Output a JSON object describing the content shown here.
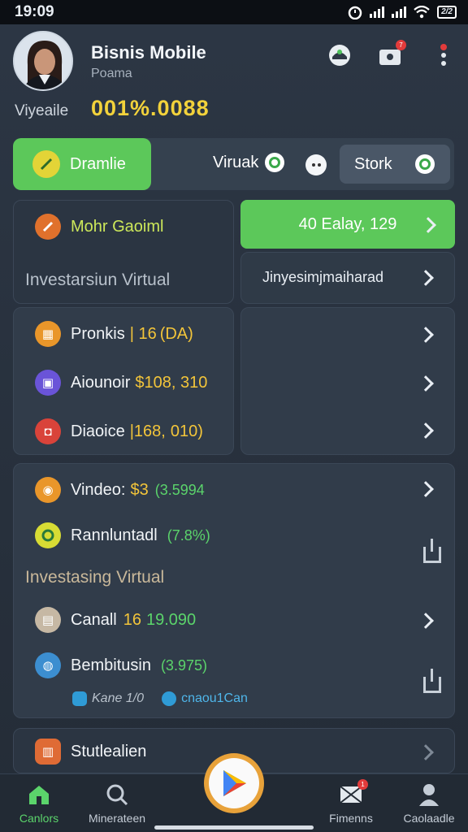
{
  "status": {
    "time": "19:09",
    "battery": "2/2"
  },
  "header": {
    "title": "Bisnis Mobile",
    "subtitle": "Poama",
    "side_label": "Viyeaile",
    "balance": "001%.0088"
  },
  "tabs": {
    "active": "Dramlie",
    "second": "Viruak",
    "third": "Stork"
  },
  "card1": {
    "title": "Mohr Gaoiml",
    "caption": "Investarsiun Virtual"
  },
  "green_bar": {
    "label": "40 Ealay, 129"
  },
  "list_right": {
    "label": "Jinyesimjmaiharad"
  },
  "card2": {
    "items": [
      {
        "name": "Pronkis",
        "amount": "| 16",
        "note": "(DA)"
      },
      {
        "name": "Aiounoir",
        "amount": "$108, 310",
        "note": ""
      },
      {
        "name": "Diaoice",
        "amount": "|168,",
        "note": "010)"
      }
    ]
  },
  "card3": {
    "items": [
      {
        "name": "Vindeo:",
        "amount": "$3",
        "note": "(3.5994"
      },
      {
        "name": "Rannluntadl",
        "amount": "",
        "note": "(7.8%)"
      }
    ],
    "section_title": "Investasing Virtual",
    "items2": [
      {
        "name": "Canall",
        "amount": "16",
        "note": "19.090"
      },
      {
        "name": "Bembitusin",
        "amount": "",
        "note": "(3.975)"
      }
    ],
    "links": [
      "Kane 1/0",
      "cnaou1Can"
    ]
  },
  "card4": {
    "label": "Stutlealien"
  },
  "nav": {
    "items": [
      "Canlors",
      "Minerateen",
      "Fimenns",
      "Caolaadle"
    ]
  },
  "colors": {
    "accent_green": "#5cc85a",
    "balance_yellow": "#f2d23b",
    "badge_red": "#e23b3b"
  }
}
